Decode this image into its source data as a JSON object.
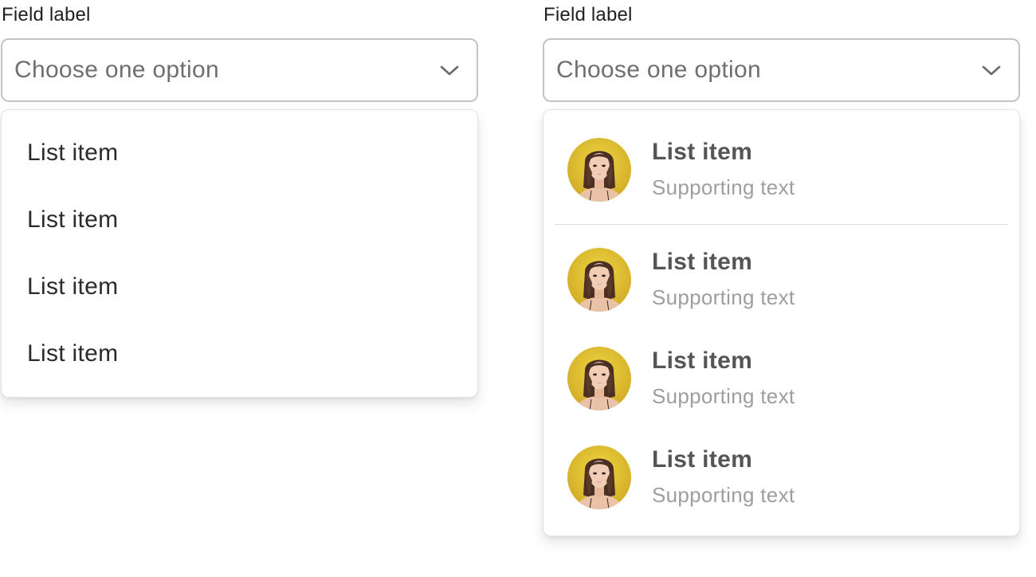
{
  "left": {
    "field_label": "Field label",
    "select": {
      "placeholder": "Choose one option",
      "icon": "chevron-down-icon"
    },
    "options": [
      {
        "label": "List item"
      },
      {
        "label": "List item"
      },
      {
        "label": "List item"
      },
      {
        "label": "List item"
      }
    ]
  },
  "right": {
    "field_label": "Field label",
    "select": {
      "placeholder": "Choose one option",
      "icon": "chevron-down-icon"
    },
    "options": [
      {
        "title": "List item",
        "supporting": "Supporting text",
        "avatar": "avatar-photo"
      },
      {
        "title": "List item",
        "supporting": "Supporting text",
        "avatar": "avatar-photo"
      },
      {
        "title": "List item",
        "supporting": "Supporting text",
        "avatar": "avatar-photo"
      },
      {
        "title": "List item",
        "supporting": "Supporting text",
        "avatar": "avatar-photo"
      }
    ]
  },
  "colors": {
    "border": "#c4c4c4",
    "placeholder": "#6f6f6f",
    "title_text": "#555555",
    "supporting_text": "#9e9e9e",
    "avatar_bg": "#e3c22f"
  }
}
